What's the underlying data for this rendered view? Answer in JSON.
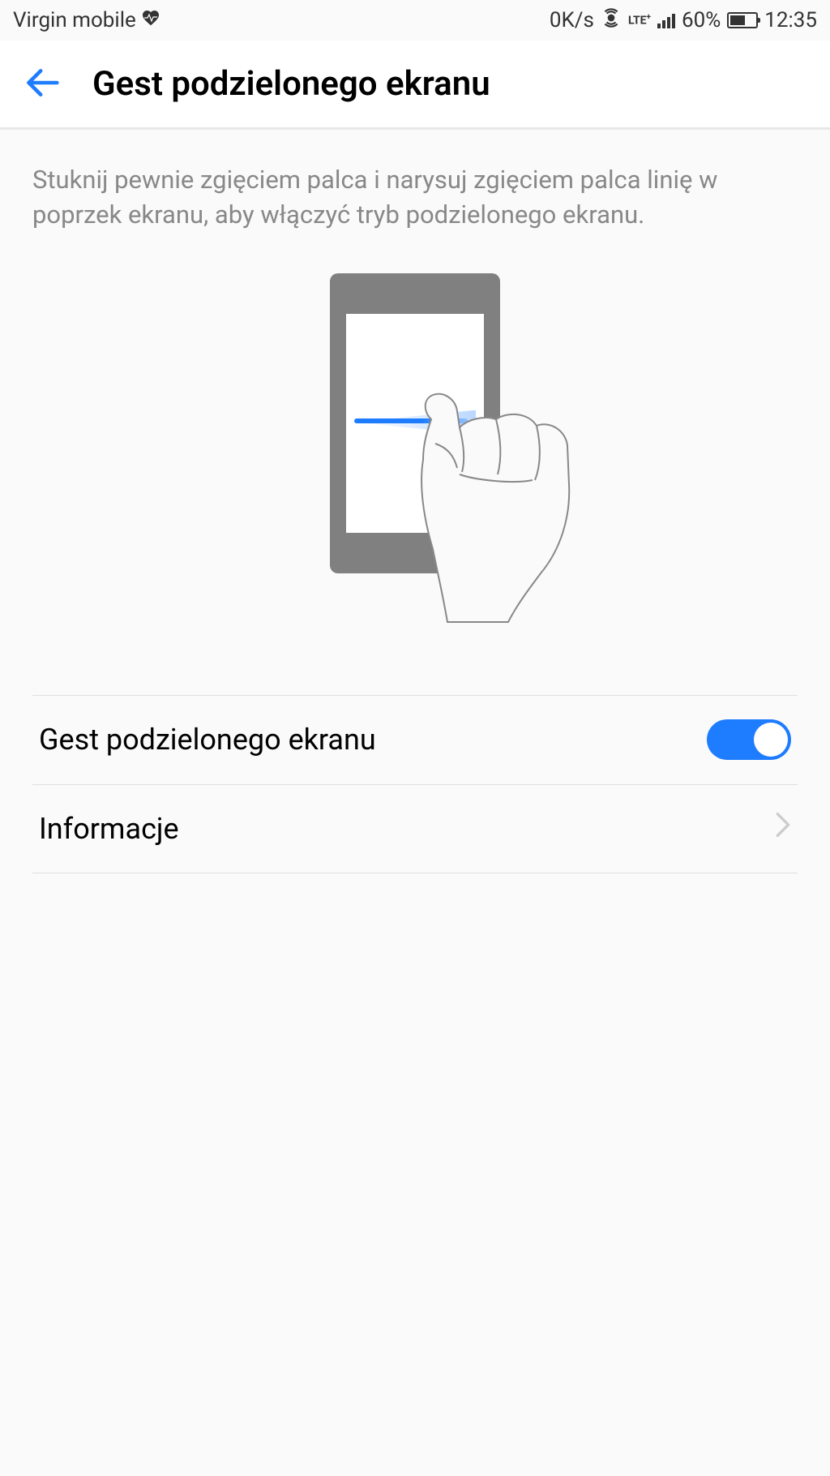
{
  "statusBar": {
    "carrier": "Virgin mobile",
    "dataSpeed": "0K/s",
    "networkType": "LTE+",
    "batteryPercent": "60%",
    "time": "12:35"
  },
  "header": {
    "title": "Gest podzielonego ekranu"
  },
  "description": "Stuknij pewnie zgięciem palca i narysuj zgięciem palca linię w poprzek ekranu, aby włączyć tryb podzielonego ekranu.",
  "settings": {
    "toggleLabel": "Gest podzielonego ekranu",
    "toggleState": true,
    "infoLabel": "Informacje"
  }
}
